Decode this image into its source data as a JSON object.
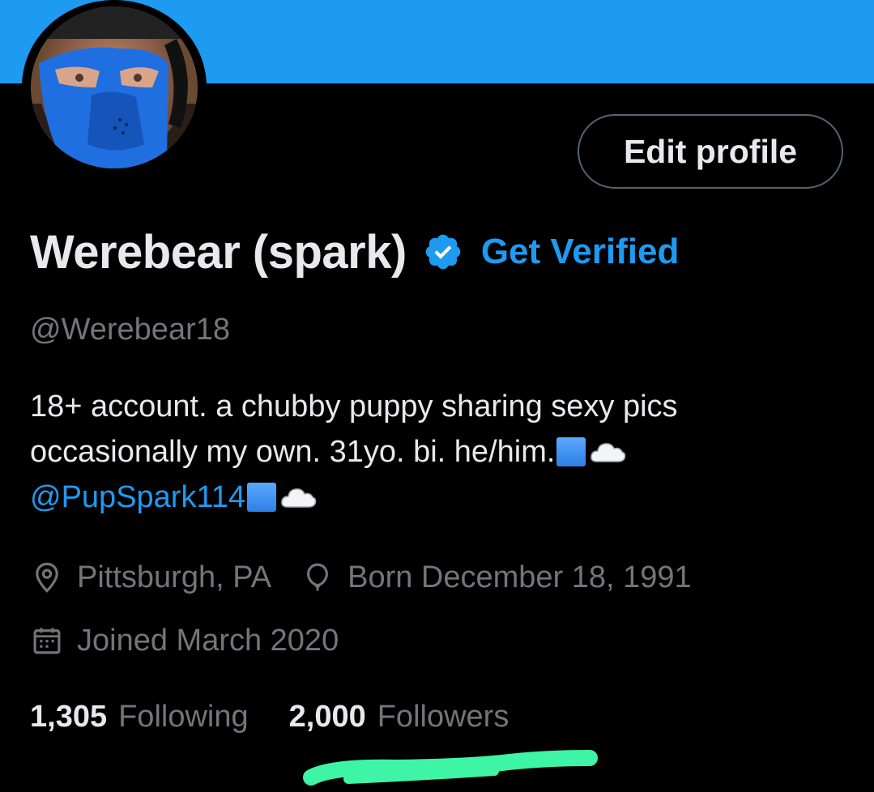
{
  "profile": {
    "display_name": "Werebear (spark)",
    "verified_icon": "verified-badge-icon",
    "get_verified_label": "Get Verified",
    "handle": "@Werebear18",
    "edit_profile_label": "Edit profile",
    "bio": {
      "line1": "18+ account. a chubby puppy sharing sexy pics",
      "line2": "occasionally my own. 31yo. bi. he/him.",
      "mention": "@PupSpark114"
    },
    "location": "Pittsburgh, PA",
    "birthday": "Born December 18, 1991",
    "joined": "Joined March 2020"
  },
  "stats": {
    "following_count": "1,305",
    "following_label": "Following",
    "followers_count": "2,000",
    "followers_label": "Followers"
  },
  "colors": {
    "banner": "#1d9bf0",
    "accent": "#1d9bf0",
    "background": "#000000",
    "text_primary": "#e7e9ea",
    "text_secondary": "#71767b",
    "highlight_stroke": "#3ef5a5"
  }
}
